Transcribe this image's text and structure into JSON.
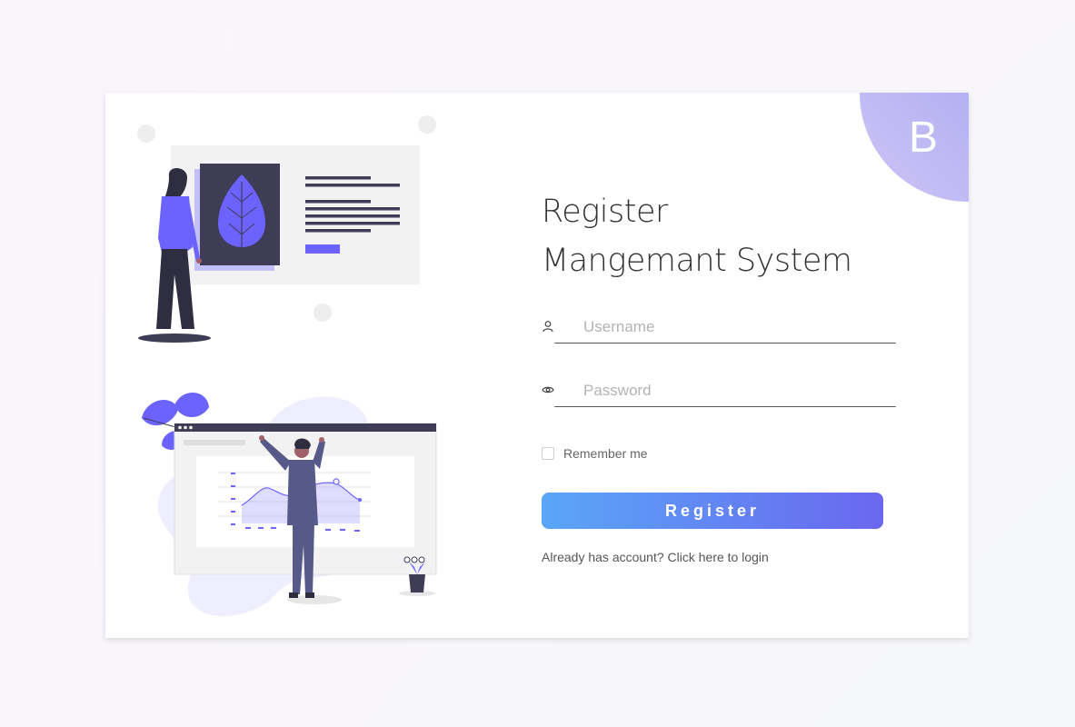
{
  "brand": {
    "corner_letter": "B",
    "accent_start": "#5aa6f8",
    "accent_end": "#6a67ee",
    "illustration_purple": "#6c63ff"
  },
  "title": {
    "line1": "Register",
    "line2": "Mangemant System"
  },
  "form": {
    "username": {
      "icon": "user-icon",
      "placeholder": "Username",
      "value": ""
    },
    "password": {
      "icon": "eye-icon",
      "placeholder": "Password",
      "value": ""
    },
    "remember_label": "Remember me",
    "remember_checked": false,
    "submit_label": "Register",
    "login_link": "Already has account? Click here to login"
  }
}
